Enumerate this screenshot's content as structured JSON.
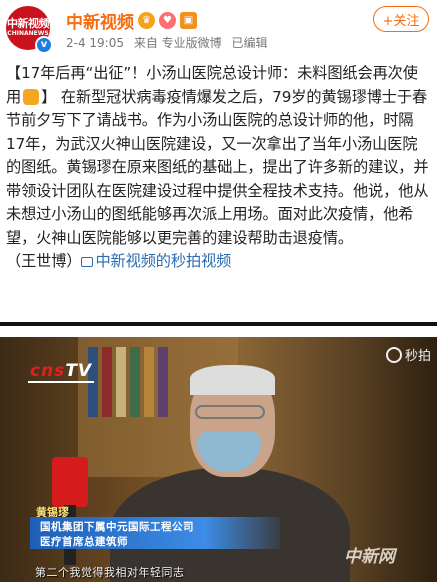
{
  "account": {
    "avatar_line1": "中新视频",
    "avatar_line2": "CHINANEWS",
    "verified_mark": "v",
    "name": "中新视频",
    "badges": [
      "crown-badge-icon",
      "heart-badge-icon",
      "vip-badge-icon"
    ],
    "date": "2-4 19:05",
    "source": "来自 专业版微博",
    "edited": "已编辑",
    "follow_label": "+关注"
  },
  "post": {
    "headline": "【17年后再“出征”！小汤山医院总设计师：未料图纸会再次使用",
    "headline_end": "】",
    "body": "在新型冠状病毒疫情爆发之后，79岁的黄锡璆博士于春节前夕写下了请战书。作为小汤山医院的总设计师的他，时隔17年，为武汉火神山医院建设，又一次拿出了当年小汤山医院的图纸。黄锡璆在原来图纸的基础上，提出了许多新的建议，并带领设计团队在医院建设过程中提供全程技术支持。他说，他从未想过小汤山的图纸能够再次派上用场。面对此次疫情，他希望，火神山医院能够以更完善的建设帮助击退疫情。",
    "credit": "（王世博）",
    "video_link": "中新视频的秒拍视频"
  },
  "video": {
    "channel_logo_prefix": "cns",
    "channel_logo_suffix": "TV",
    "miaopai_label": "秒拍",
    "speaker_name": "黄锡璆",
    "speaker_title_1": "国机集团下属中元国际工程公司",
    "speaker_title_2": "医疗首席总建筑师",
    "watermark": "中新网",
    "subtitle": "第二个我觉得我相对年轻同志"
  },
  "colors": {
    "brand_orange": "#f86c0d",
    "link_blue": "#2b6cb0",
    "verified_blue": "#1f7de2"
  }
}
